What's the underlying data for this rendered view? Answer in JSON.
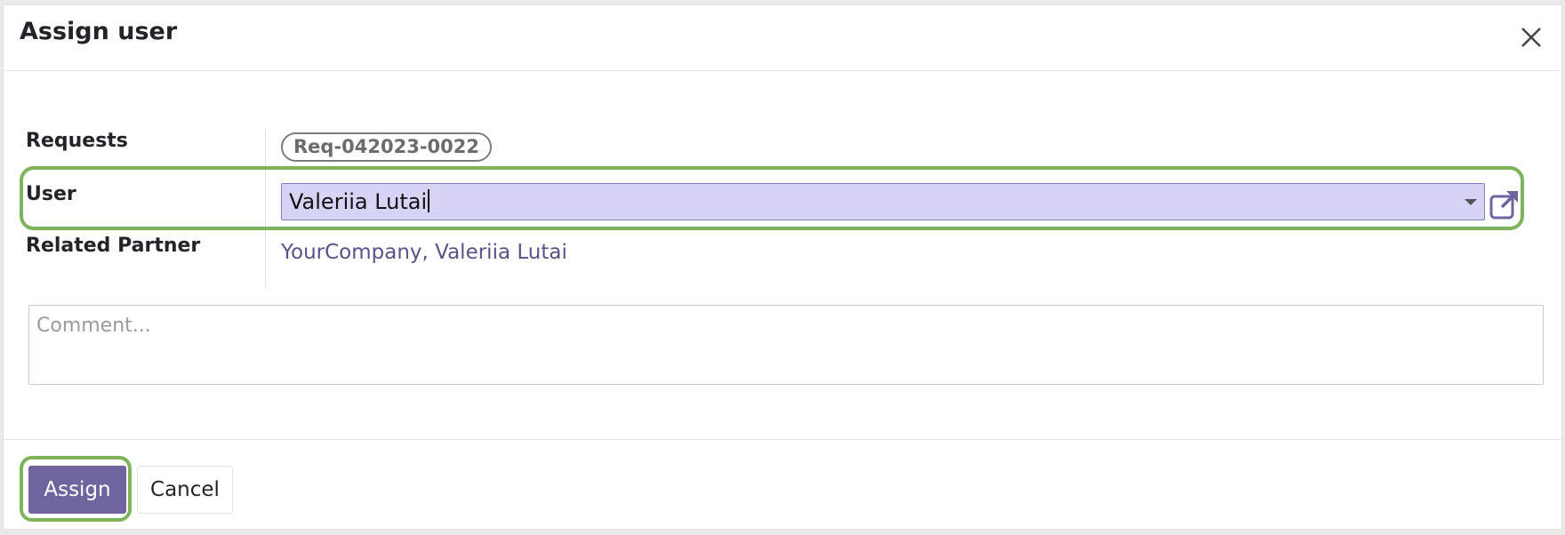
{
  "dialog": {
    "title": "Assign user"
  },
  "form": {
    "requests_label": "Requests",
    "request_badge": "Req-042023-0022",
    "user_label": "User",
    "user_value": "Valeriia Lutai",
    "related_partner_label": "Related Partner",
    "related_partner_value": "YourCompany, Valeriia Lutai",
    "comment_placeholder": "Comment..."
  },
  "footer": {
    "assign_label": "Assign",
    "cancel_label": "Cancel"
  },
  "colors": {
    "accent": "#71639e",
    "highlight": "#7db35a",
    "input_bg": "#d5d4f7",
    "link": "#5d4f8a"
  },
  "icons": {
    "close": "close-icon",
    "dropdown": "chevron-down-icon",
    "external": "external-link-icon"
  }
}
